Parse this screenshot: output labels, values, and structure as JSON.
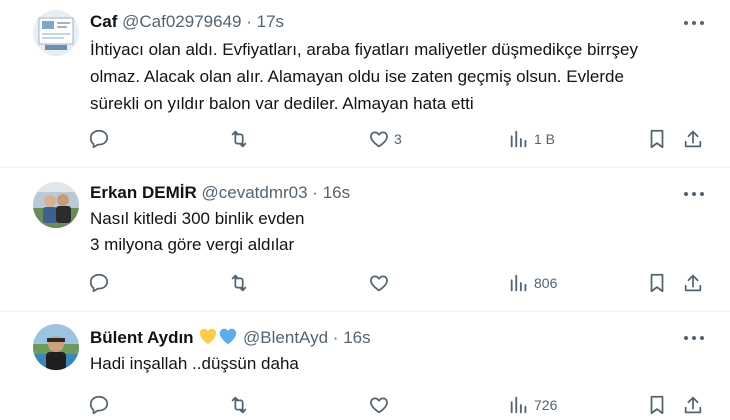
{
  "tweets": [
    {
      "name": "Caf",
      "handle": "@Caf02979649",
      "separator": "·",
      "time": "17s",
      "lines": [
        "İhtiyacı olan aldı. Evfiyatları, araba fiyatları maliyetler düşmedikçe birrşey",
        "olmaz. Alacak olan alır. Alamayan oldu ise zaten geçmiş olsun. Evlerde",
        "sürekli on yıldır balon var dediler. Almayan hata etti"
      ],
      "likes": "3",
      "views": "1 B"
    },
    {
      "name": "Erkan DEMİR",
      "handle": "@cevatdmr03",
      "separator": "·",
      "time": "16s",
      "lines": [
        "Nasıl kitledi 300 binlik evden",
        "3 milyona göre vergi aldılar"
      ],
      "likes": "",
      "views": "806"
    },
    {
      "name": "Bülent Aydın",
      "handle": "@BlentAyd",
      "separator": "·",
      "time": "16s",
      "lines": [
        "Hadi inşallah ..düşsün daha"
      ],
      "likes": "",
      "views": "726"
    }
  ],
  "colors": {
    "text": "#0f1419",
    "secondary": "#536471",
    "divider": "#eff3f4",
    "heart_yellow": "#ffcc4d",
    "heart_blue": "#5dadec"
  },
  "icons": {
    "reply": "reply-icon",
    "retweet": "retweet-icon",
    "like": "like-icon",
    "views": "views-icon",
    "bookmark": "bookmark-icon",
    "share": "share-icon"
  }
}
